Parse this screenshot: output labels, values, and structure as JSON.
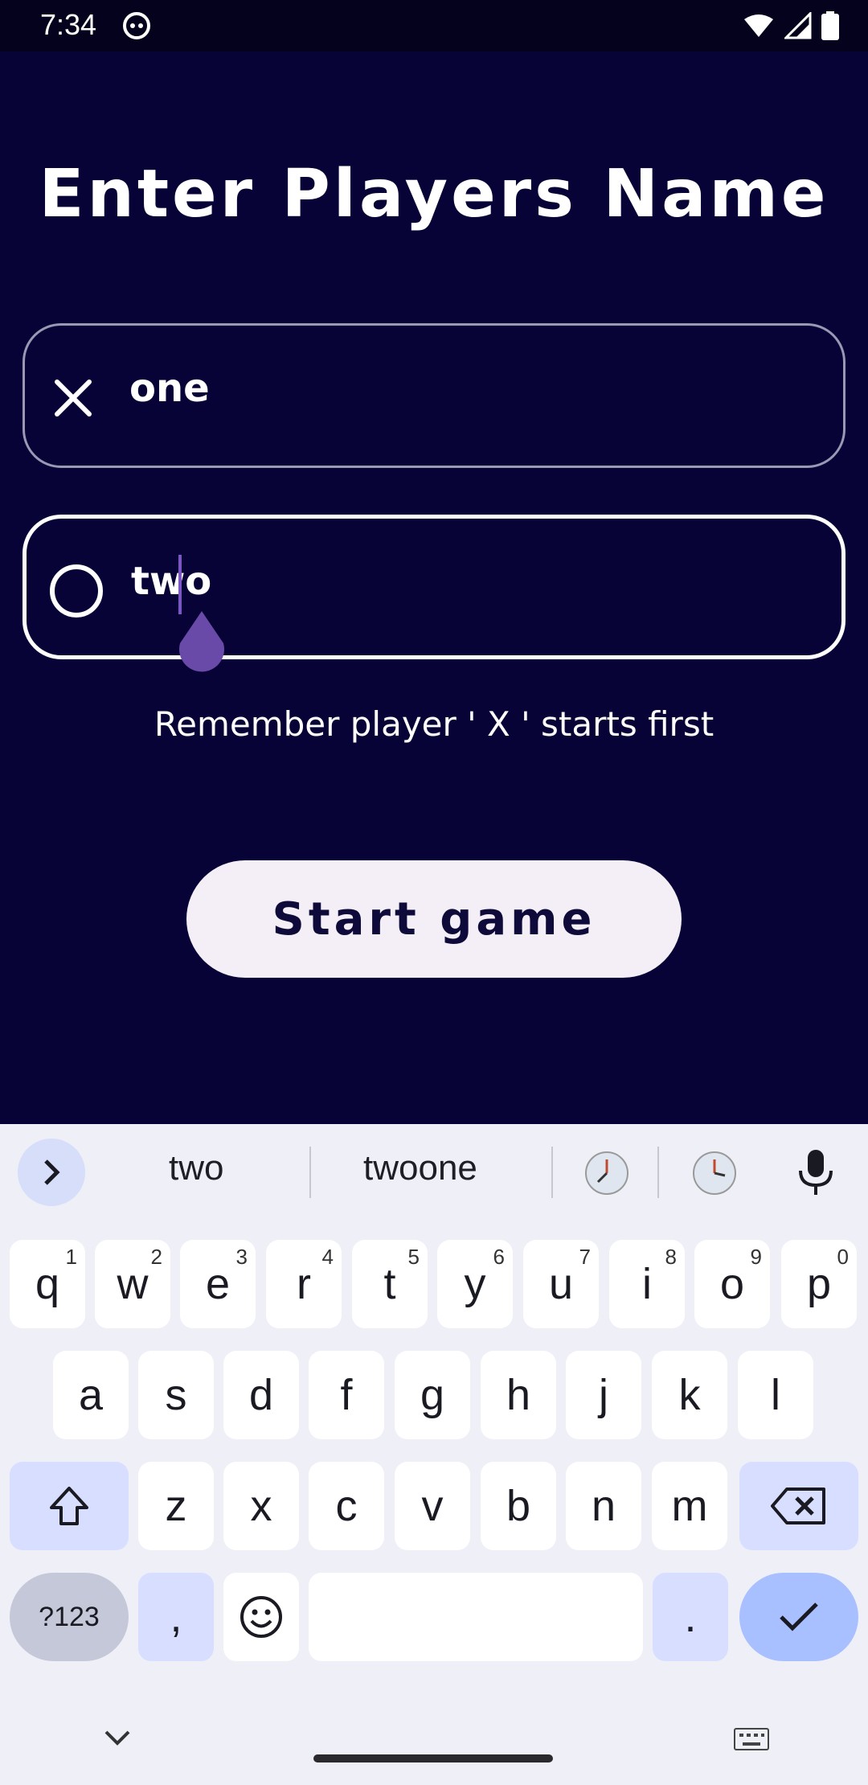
{
  "status_bar": {
    "time": "7:34"
  },
  "header": {
    "title": "Enter Players Name"
  },
  "players": [
    {
      "name": "one",
      "symbol": "x-icon"
    },
    {
      "name": "two",
      "symbol": "circle-icon"
    }
  ],
  "hint": "Remember player ' X ' starts first",
  "actions": {
    "start_label": "Start game"
  },
  "keyboard": {
    "suggestions": [
      "two",
      "twoone"
    ],
    "row1": [
      {
        "k": "q",
        "n": "1"
      },
      {
        "k": "w",
        "n": "2"
      },
      {
        "k": "e",
        "n": "3"
      },
      {
        "k": "r",
        "n": "4"
      },
      {
        "k": "t",
        "n": "5"
      },
      {
        "k": "y",
        "n": "6"
      },
      {
        "k": "u",
        "n": "7"
      },
      {
        "k": "i",
        "n": "8"
      },
      {
        "k": "o",
        "n": "9"
      },
      {
        "k": "p",
        "n": "0"
      }
    ],
    "row2": [
      "a",
      "s",
      "d",
      "f",
      "g",
      "h",
      "j",
      "k",
      "l"
    ],
    "row3": [
      "z",
      "x",
      "c",
      "v",
      "b",
      "n",
      "m"
    ],
    "symbols_label": "?123",
    "comma": ",",
    "period": "."
  },
  "colors": {
    "background": "#070336",
    "accent": "#7b56c4",
    "button_bg": "#f4eff6"
  }
}
